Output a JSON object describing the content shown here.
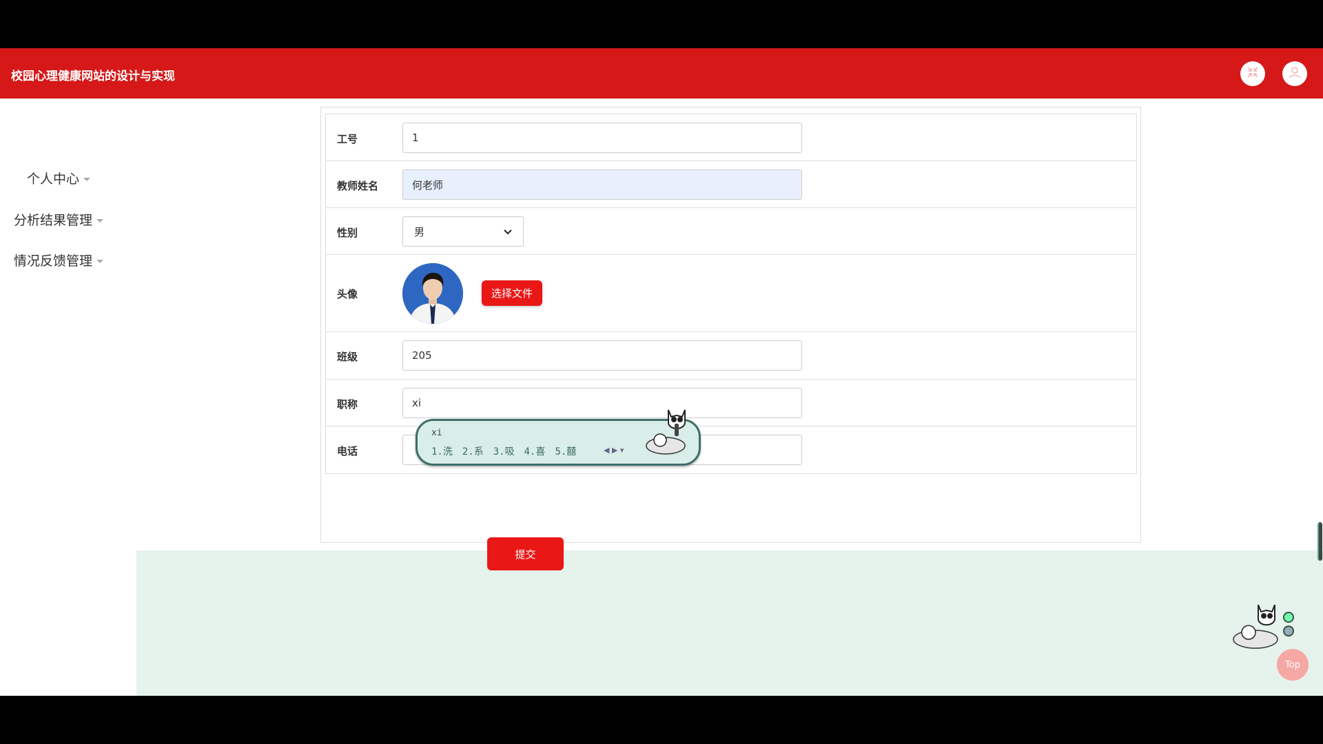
{
  "app": {
    "title": "校园心理健康网站的设计与实现"
  },
  "header_icons": [
    "fullscreen-exit-icon",
    "user-icon"
  ],
  "sidebar": {
    "items": [
      {
        "label": "个人中心"
      },
      {
        "label": "分析结果管理"
      },
      {
        "label": "情况反馈管理"
      }
    ]
  },
  "form": {
    "fields": {
      "job_number": {
        "label": "工号",
        "value": "1"
      },
      "teacher_name": {
        "label": "教师姓名",
        "value": "何老师"
      },
      "gender": {
        "label": "性别",
        "value": "男"
      },
      "avatar": {
        "label": "头像",
        "button": "选择文件"
      },
      "class": {
        "label": "班级",
        "value": "205"
      },
      "title": {
        "label": "职称",
        "value": "xi"
      },
      "phone": {
        "label": "电话",
        "value": ""
      }
    },
    "submit_label": "提交"
  },
  "ime": {
    "composition": "xi",
    "candidates": [
      "1.洗",
      "2.系",
      "3.吸",
      "4.喜",
      "5.囍"
    ]
  },
  "back_to_top": {
    "label": "Top"
  },
  "colors": {
    "brand_red": "#d61818",
    "button_red": "#ea1717",
    "footer_green": "#e6f2ec"
  }
}
